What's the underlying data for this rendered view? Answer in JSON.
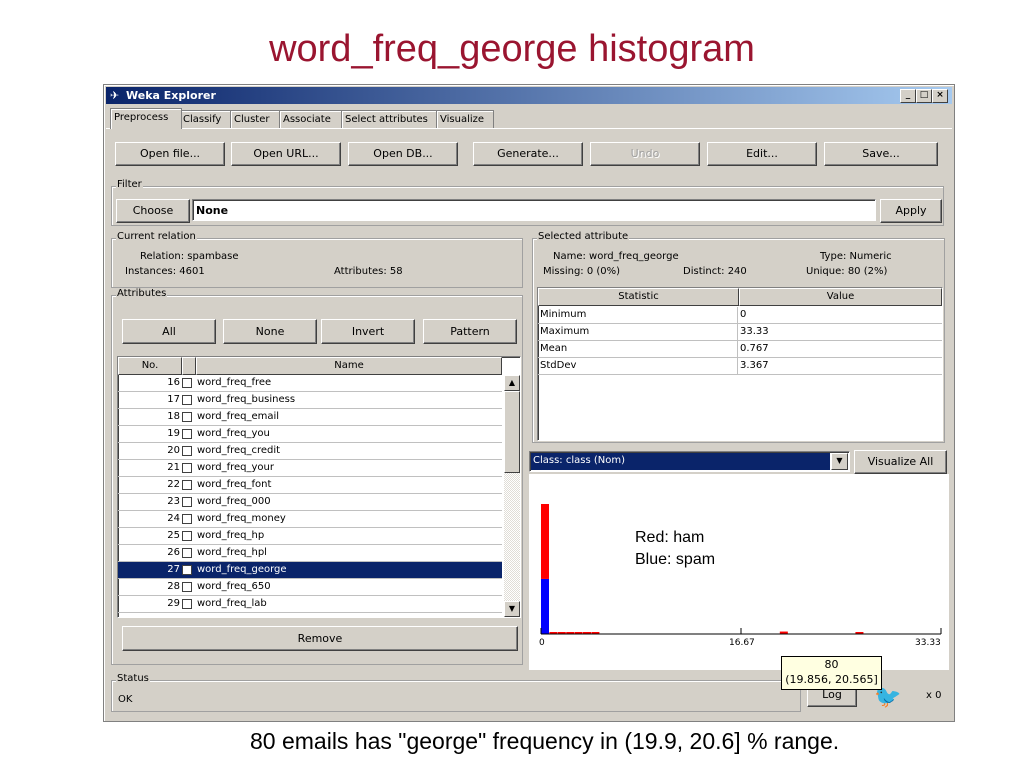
{
  "slide": {
    "title": "word_freq_george histogram",
    "caption": "80 emails has \"george\" frequency in (19.9, 20.6] % range."
  },
  "window": {
    "title": "Weka Explorer",
    "icon": "weka-bird-icon",
    "controls": [
      "_",
      "□",
      "×"
    ]
  },
  "tabs": [
    "Preprocess",
    "Classify",
    "Cluster",
    "Associate",
    "Select attributes",
    "Visualize"
  ],
  "active_tab": "Preprocess",
  "toolbar": {
    "open_file": "Open file...",
    "open_url": "Open URL...",
    "open_db": "Open DB...",
    "generate": "Generate...",
    "undo": "Undo",
    "edit": "Edit...",
    "save": "Save..."
  },
  "filter": {
    "label": "Filter",
    "choose": "Choose",
    "value": "None",
    "apply": "Apply"
  },
  "current_relation": {
    "label": "Current relation",
    "relation": "Relation: spambase",
    "instances": "Instances: 4601",
    "attributes": "Attributes: 58"
  },
  "attributes": {
    "label": "Attributes",
    "buttons": {
      "all": "All",
      "none": "None",
      "invert": "Invert",
      "pattern": "Pattern"
    },
    "col_no": "No.",
    "col_name": "Name",
    "rows": [
      {
        "no": "16",
        "name": "word_freq_free",
        "selected": false
      },
      {
        "no": "17",
        "name": "word_freq_business",
        "selected": false
      },
      {
        "no": "18",
        "name": "word_freq_email",
        "selected": false
      },
      {
        "no": "19",
        "name": "word_freq_you",
        "selected": false
      },
      {
        "no": "20",
        "name": "word_freq_credit",
        "selected": false
      },
      {
        "no": "21",
        "name": "word_freq_your",
        "selected": false
      },
      {
        "no": "22",
        "name": "word_freq_font",
        "selected": false
      },
      {
        "no": "23",
        "name": "word_freq_000",
        "selected": false
      },
      {
        "no": "24",
        "name": "word_freq_money",
        "selected": false
      },
      {
        "no": "25",
        "name": "word_freq_hp",
        "selected": false
      },
      {
        "no": "26",
        "name": "word_freq_hpl",
        "selected": false
      },
      {
        "no": "27",
        "name": "word_freq_george",
        "selected": true
      },
      {
        "no": "28",
        "name": "word_freq_650",
        "selected": false
      },
      {
        "no": "29",
        "name": "word_freq_lab",
        "selected": false
      }
    ],
    "remove": "Remove"
  },
  "selected_attribute": {
    "label": "Selected attribute",
    "name": "Name: word_freq_george",
    "type": "Type: Numeric",
    "missing": "Missing: 0 (0%)",
    "distinct": "Distinct: 240",
    "unique": "Unique: 80 (2%)",
    "col_statistic": "Statistic",
    "col_value": "Value",
    "stats": [
      {
        "k": "Minimum",
        "v": "0"
      },
      {
        "k": "Maximum",
        "v": "33.33"
      },
      {
        "k": "Mean",
        "v": "0.767"
      },
      {
        "k": "StdDev",
        "v": "3.367"
      }
    ]
  },
  "class_select": {
    "value": "Class: class (Nom)",
    "visualize_all": "Visualize All"
  },
  "histogram": {
    "legend_red": "Red: ham",
    "legend_blue": "Blue: spam",
    "tick_labels": [
      "0",
      "16.67",
      "33.33"
    ],
    "tooltip_count": "80",
    "tooltip_range": "(19.856, 20.565]",
    "colors": {
      "ham": "#ff0000",
      "spam": "#0000ff"
    }
  },
  "chart_data": {
    "type": "bar",
    "xlim": [
      0,
      33.33
    ],
    "bins": [
      {
        "x": 0.0,
        "blue": 1800,
        "red": 2450
      },
      {
        "x": 0.7,
        "blue": 0,
        "red": 45
      },
      {
        "x": 1.4,
        "blue": 0,
        "red": 30
      },
      {
        "x": 2.1,
        "blue": 0,
        "red": 18
      },
      {
        "x": 2.8,
        "blue": 0,
        "red": 10
      },
      {
        "x": 3.5,
        "blue": 0,
        "red": 6
      },
      {
        "x": 4.2,
        "blue": 0,
        "red": 5
      },
      {
        "x": 19.9,
        "blue": 0,
        "red": 80
      },
      {
        "x": 26.2,
        "blue": 0,
        "red": 8
      }
    ],
    "series": [
      {
        "name": "Red: ham",
        "color": "#ff0000"
      },
      {
        "name": "Blue: spam",
        "color": "#0000ff"
      }
    ]
  },
  "status": {
    "label": "Status",
    "text": "OK",
    "log": "Log",
    "count": "x 0"
  }
}
